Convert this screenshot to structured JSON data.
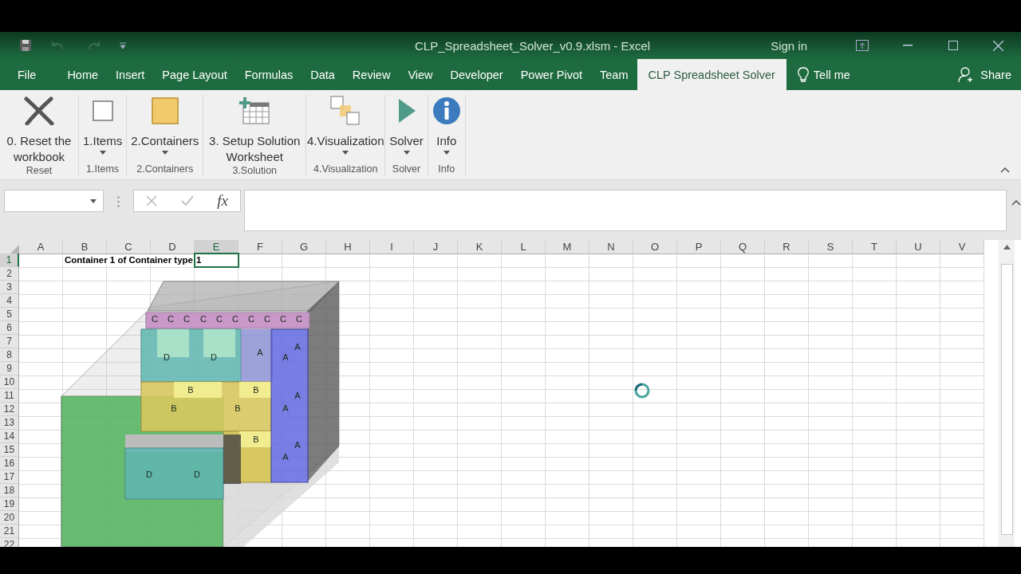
{
  "window": {
    "title": "CLP_Spreadsheet_Solver_v0.9.xlsm  -  Excel",
    "sign_in": "Sign in"
  },
  "tabs": [
    {
      "label": "File",
      "selected": false
    },
    {
      "label": "Home",
      "selected": false
    },
    {
      "label": "Insert",
      "selected": false
    },
    {
      "label": "Page Layout",
      "selected": false
    },
    {
      "label": "Formulas",
      "selected": false
    },
    {
      "label": "Data",
      "selected": false
    },
    {
      "label": "Review",
      "selected": false
    },
    {
      "label": "View",
      "selected": false
    },
    {
      "label": "Developer",
      "selected": false
    },
    {
      "label": "Power Pivot",
      "selected": false
    },
    {
      "label": "Team",
      "selected": false
    },
    {
      "label": "CLP Spreadsheet Solver",
      "selected": true
    }
  ],
  "tell_me": "Tell me",
  "share": "Share",
  "ribbon_groups": [
    {
      "label": "Reset",
      "button": {
        "kind": "reset",
        "label": "0. Reset the workbook",
        "dropdown": false
      }
    },
    {
      "label": "1.Items",
      "button": {
        "kind": "items",
        "label": "1.Items",
        "dropdown": true
      }
    },
    {
      "label": "2.Containers",
      "button": {
        "kind": "containers",
        "label": "2.Containers",
        "dropdown": true
      }
    },
    {
      "label": "3.Solution",
      "button": {
        "kind": "setup",
        "label": "3. Setup Solution Worksheet",
        "dropdown": false
      }
    },
    {
      "label": "4.Visualization",
      "button": {
        "kind": "visualization",
        "label": "4.Visualization",
        "dropdown": true
      }
    },
    {
      "label": "Solver",
      "button": {
        "kind": "solver",
        "label": "Solver",
        "dropdown": true
      }
    },
    {
      "label": "Info",
      "button": {
        "kind": "info",
        "label": "Info",
        "dropdown": true
      }
    }
  ],
  "formula_bar": {
    "function_label": "fx"
  },
  "sheet": {
    "columns": [
      {
        "label": "A",
        "selected": false
      },
      {
        "label": "B",
        "selected": false
      },
      {
        "label": "C",
        "selected": false
      },
      {
        "label": "D",
        "selected": false
      },
      {
        "label": "E",
        "selected": true
      },
      {
        "label": "F",
        "selected": false
      },
      {
        "label": "G",
        "selected": false
      },
      {
        "label": "H",
        "selected": false
      },
      {
        "label": "I",
        "selected": false
      },
      {
        "label": "J",
        "selected": false
      },
      {
        "label": "K",
        "selected": false
      },
      {
        "label": "L",
        "selected": false
      },
      {
        "label": "M",
        "selected": false
      },
      {
        "label": "N",
        "selected": false
      },
      {
        "label": "O",
        "selected": false
      },
      {
        "label": "P",
        "selected": false
      },
      {
        "label": "Q",
        "selected": false
      },
      {
        "label": "R",
        "selected": false
      },
      {
        "label": "S",
        "selected": false
      },
      {
        "label": "T",
        "selected": false
      },
      {
        "label": "U",
        "selected": false
      },
      {
        "label": "V",
        "selected": false
      }
    ],
    "rows": [
      {
        "label": "1",
        "selected": true,
        "cells": {
          "B": {
            "text": "Container 1 of Container type",
            "selected": false
          },
          "E": {
            "text": "1",
            "selected": true
          }
        }
      },
      {
        "label": "2",
        "selected": false
      },
      {
        "label": "3",
        "selected": false
      },
      {
        "label": "4",
        "selected": false
      },
      {
        "label": "5",
        "selected": false
      },
      {
        "label": "6",
        "selected": false
      },
      {
        "label": "7",
        "selected": false
      },
      {
        "label": "8",
        "selected": false
      },
      {
        "label": "9",
        "selected": false
      },
      {
        "label": "10",
        "selected": false
      },
      {
        "label": "11",
        "selected": false
      },
      {
        "label": "12",
        "selected": false
      },
      {
        "label": "13",
        "selected": false
      },
      {
        "label": "14",
        "selected": false
      },
      {
        "label": "15",
        "selected": false
      },
      {
        "label": "16",
        "selected": false
      },
      {
        "label": "17",
        "selected": false
      },
      {
        "label": "18",
        "selected": false
      },
      {
        "label": "19",
        "selected": false
      },
      {
        "label": "20",
        "selected": false
      },
      {
        "label": "21",
        "selected": false
      },
      {
        "label": "22",
        "selected": false
      }
    ]
  },
  "visualization": {
    "box_labels": [
      "C",
      "C",
      "C",
      "C",
      "C",
      "C",
      "C",
      "C",
      "C",
      "C",
      "D",
      "D",
      "A",
      "A",
      "A",
      "B",
      "B",
      "B",
      "B",
      "A",
      "A",
      "B",
      "A",
      "A",
      "D",
      "D"
    ]
  }
}
